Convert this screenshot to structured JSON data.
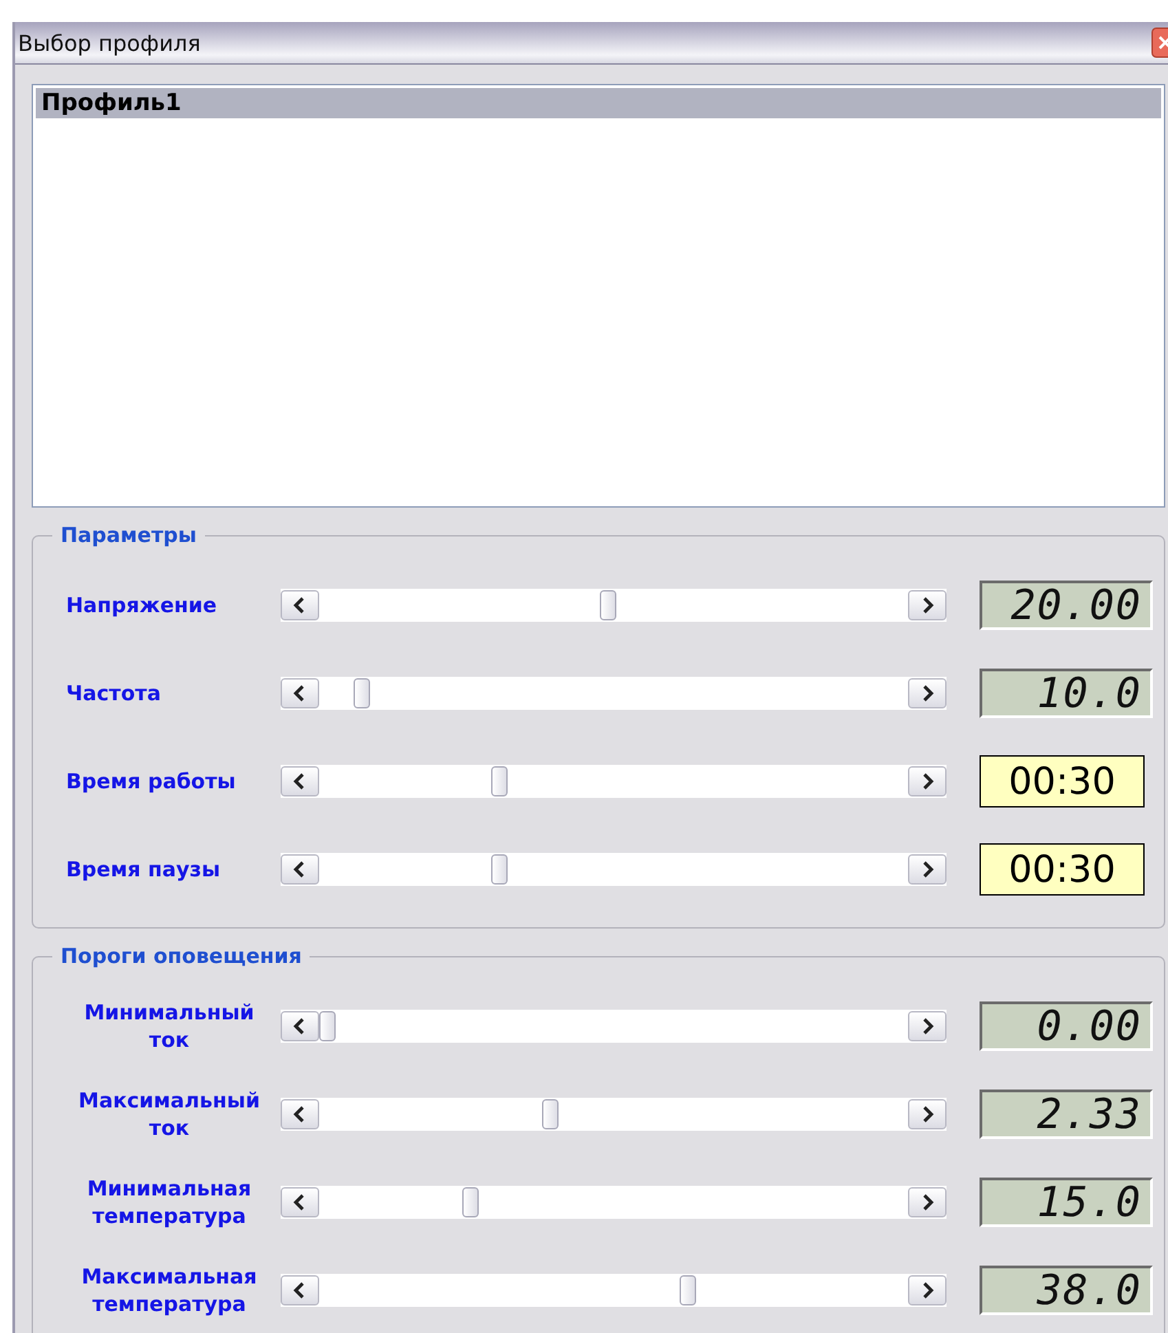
{
  "window": {
    "title": "Выбор профиля"
  },
  "profiles": [
    {
      "name": "Профиль1",
      "selected": true
    }
  ],
  "groups": [
    {
      "title": "Параметры",
      "rows": [
        {
          "label": "Напряжение",
          "level": 0.49,
          "reading": "20.00",
          "kind": "lcd"
        },
        {
          "label": "Частота",
          "level": 0.06,
          "reading": "10.0",
          "kind": "lcd"
        },
        {
          "label": "Время работы",
          "level": 0.3,
          "reading": "00:30",
          "kind": "time"
        },
        {
          "label": "Время паузы",
          "level": 0.3,
          "reading": "00:30",
          "kind": "time"
        }
      ]
    },
    {
      "title": "Пороги оповещения",
      "rows": [
        {
          "label": "Минимальный ток",
          "level": 0.0,
          "reading": "0.00",
          "kind": "lcd"
        },
        {
          "label": "Максимальный ток",
          "level": 0.39,
          "reading": "2.33",
          "kind": "lcd"
        },
        {
          "label": "Минимальная температура",
          "level": 0.25,
          "reading": "15.0",
          "kind": "lcd"
        },
        {
          "label": "Максимальная температура",
          "level": 0.63,
          "reading": "38.0",
          "kind": "lcd"
        }
      ]
    }
  ]
}
